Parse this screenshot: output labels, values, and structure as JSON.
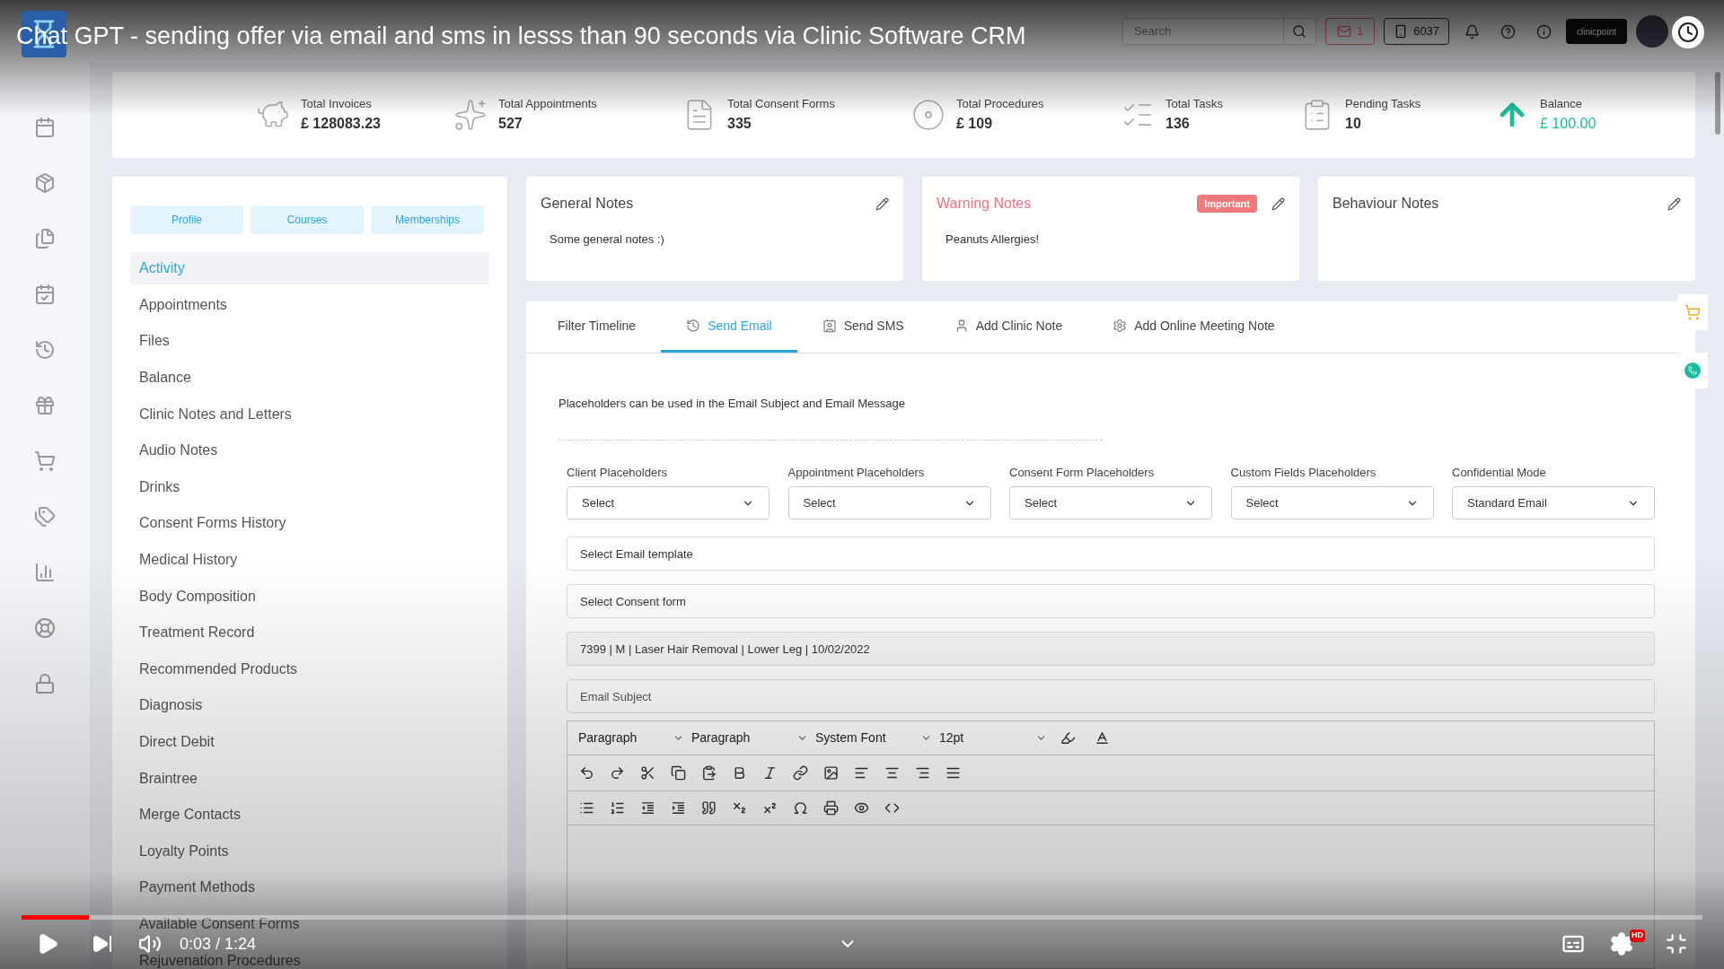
{
  "video": {
    "title": "Chat GPT - sending offer via email and sms in lesss than 90 seconds via Clinic Software CRM",
    "time": "0:03 / 1:24",
    "level": 0.04,
    "hd_badge": "HD"
  },
  "header": {
    "search": {
      "placeholder": "Search"
    },
    "mail_count": "1",
    "phone_count": "6037",
    "brand": "clinicpoint"
  },
  "stats": [
    {
      "kind": "invoices",
      "label": "Total Invoices",
      "value": "£ 128083.23"
    },
    {
      "kind": "appointments",
      "label": "Total Appointments",
      "value": "527"
    },
    {
      "kind": "consent",
      "label": "Total Consent Forms",
      "value": "335"
    },
    {
      "kind": "procedures",
      "label": "Total Procedures",
      "value": "£ 109"
    },
    {
      "kind": "tasks",
      "label": "Total Tasks",
      "value": "136"
    },
    {
      "kind": "pending",
      "label": "Pending Tasks",
      "value": "10"
    },
    {
      "kind": "balance",
      "label": "Balance",
      "value": "£ 100.00"
    }
  ],
  "profile_tabs": [
    "Profile",
    "Courses",
    "Memberships"
  ],
  "menu": [
    {
      "label": "Activity",
      "selected": true
    },
    {
      "label": "Appointments",
      "selected": false
    },
    {
      "label": "Files",
      "selected": false
    },
    {
      "label": "Balance",
      "selected": false
    },
    {
      "label": "Clinic Notes and Letters",
      "selected": false
    },
    {
      "label": "Audio Notes",
      "selected": false
    },
    {
      "label": "Drinks",
      "selected": false
    },
    {
      "label": "Consent Forms History",
      "selected": false
    },
    {
      "label": "Medical History",
      "selected": false
    },
    {
      "label": "Body Composition",
      "selected": false
    },
    {
      "label": "Treatment Record",
      "selected": false
    },
    {
      "label": "Recommended Products",
      "selected": false
    },
    {
      "label": "Diagnosis",
      "selected": false
    },
    {
      "label": "Direct Debit",
      "selected": false
    },
    {
      "label": "Braintree",
      "selected": false
    },
    {
      "label": "Merge Contacts",
      "selected": false
    },
    {
      "label": "Loyalty Points",
      "selected": false
    },
    {
      "label": "Payment Methods",
      "selected": false
    },
    {
      "label": "Available Consent Forms",
      "selected": false
    },
    {
      "label": "Rejuvenation Procedures",
      "selected": false
    }
  ],
  "notes": [
    {
      "kind": "general",
      "title": "General Notes",
      "text": "Some general notes :)"
    },
    {
      "kind": "warning",
      "title": "Warning Notes",
      "badge": "Important",
      "text": "Peanuts Allergies!"
    },
    {
      "kind": "behaviour",
      "title": "Behaviour Notes"
    }
  ],
  "tabs": [
    {
      "kind": "filter",
      "label": "Filter Timeline",
      "selected": false
    },
    {
      "kind": "email",
      "label": "Send Email",
      "selected": true
    },
    {
      "kind": "sms",
      "label": "Send SMS",
      "selected": false
    },
    {
      "kind": "clinic_note",
      "label": "Add Clinic Note",
      "selected": false
    },
    {
      "kind": "meeting_note",
      "label": "Add Online Meeting Note",
      "selected": false
    }
  ],
  "email_form": {
    "hint": "Placeholders can be used in the Email Subject and Email Message",
    "selects": [
      {
        "label": "Client Placeholders",
        "value": "Select"
      },
      {
        "label": "Appointment Placeholders",
        "value": "Select"
      },
      {
        "label": "Consent Form Placeholders",
        "value": "Select"
      },
      {
        "label": "Custom Fields Placeholders",
        "value": "Select"
      },
      {
        "label": "Confidential Mode",
        "value": "Standard Email"
      }
    ],
    "template": {
      "placeholder": "Select Email template"
    },
    "consent": {
      "placeholder": "Select Consent form"
    },
    "record": {
      "value": "7399 | M | Laser Hair Removal | Lower Leg | 10/02/2022"
    },
    "subject": {
      "placeholder": "Email Subject"
    },
    "toolbar": {
      "block": "Paragraph",
      "format": "Paragraph",
      "font": "System Font",
      "size": "12pt"
    }
  }
}
